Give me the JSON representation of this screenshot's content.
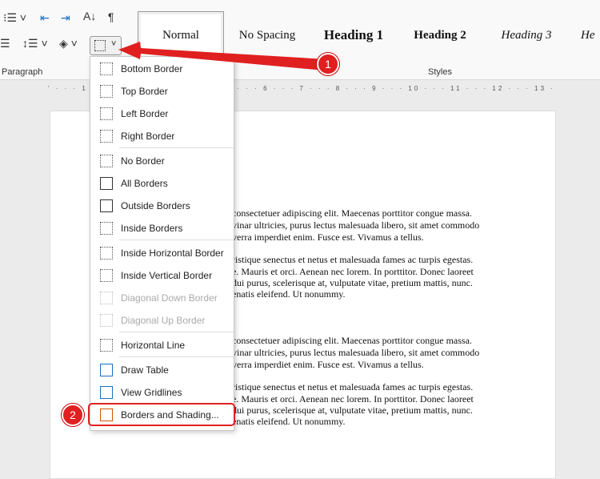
{
  "ribbon": {
    "icons": [
      "multilevel-list-icon",
      "decrease-indent-icon",
      "increase-indent-icon",
      "sort-icon",
      "pilcrow-icon",
      "justify-icon",
      "line-spacing-icon",
      "shading-icon",
      "borders-icon"
    ],
    "paragraph_label": "Paragraph",
    "styles_label": "Styles",
    "styles": [
      "Normal",
      "No Spacing",
      "Heading 1",
      "Heading 2",
      "Heading 3",
      "He"
    ]
  },
  "ruler": "' · · · 1 · · · 2 · · · 3 · · · 4 · · · 5 · · · 6 · · · 7 · · · 8 · · · 9 · · · 10 · · · 11 · · · 12 · · · 13 · · · 14",
  "document": {
    "lines": [
      "consectetuer adipiscing elit. Maecenas porttitor congue massa.",
      "vinar ultricies, purus lectus malesuada libero, sit amet commodo",
      "verra imperdiet enim. Fusce est. Vivamus a tellus.",
      "ristique senectus et netus et malesuada fames ac turpis egestas.",
      "e. Mauris et orci. Aenean nec lorem. In porttitor. Donec laoreet",
      "dui purus, scelerisque at, vulputate vitae, pretium mattis, nunc.",
      "enatis eleifend. Ut nonummy.",
      "consectetuer adipiscing elit. Maecenas porttitor congue massa.",
      "vinar ultricies, purus lectus malesuada libero, sit amet commodo",
      "verra imperdiet enim. Fusce est. Vivamus a tellus.",
      "ristique senectus et netus et malesuada fames ac turpis egestas.",
      "e. Mauris et orci. Aenean nec lorem. In porttitor. Donec laoreet",
      "dui purus, scelerisque at, vulputate vitae, pretium mattis, nunc.",
      "enatis eleifend. Ut nonummy."
    ]
  },
  "menu": {
    "items": [
      {
        "label": "Bottom Border",
        "icon": "bottom-border-icon"
      },
      {
        "label": "Top Border",
        "icon": "top-border-icon"
      },
      {
        "label": "Left Border",
        "icon": "left-border-icon"
      },
      {
        "label": "Right Border",
        "icon": "right-border-icon"
      },
      {
        "label": "No Border",
        "icon": "no-border-icon"
      },
      {
        "label": "All Borders",
        "icon": "all-borders-icon"
      },
      {
        "label": "Outside Borders",
        "icon": "outside-borders-icon"
      },
      {
        "label": "Inside Borders",
        "icon": "inside-borders-icon"
      },
      {
        "label": "Inside Horizontal Border",
        "icon": "inside-horizontal-border-icon"
      },
      {
        "label": "Inside Vertical Border",
        "icon": "inside-vertical-border-icon"
      },
      {
        "label": "Diagonal Down Border",
        "icon": "diagonal-down-border-icon",
        "disabled": true
      },
      {
        "label": "Diagonal Up Border",
        "icon": "diagonal-up-border-icon",
        "disabled": true
      },
      {
        "label": "Horizontal Line",
        "icon": "horizontal-line-icon"
      },
      {
        "label": "Draw Table",
        "icon": "draw-table-icon"
      },
      {
        "label": "View Gridlines",
        "icon": "view-gridlines-icon"
      },
      {
        "label": "Borders and Shading...",
        "icon": "borders-shading-icon"
      }
    ]
  },
  "annotations": {
    "step1": "1",
    "step2": "2",
    "color": "#e02020"
  }
}
